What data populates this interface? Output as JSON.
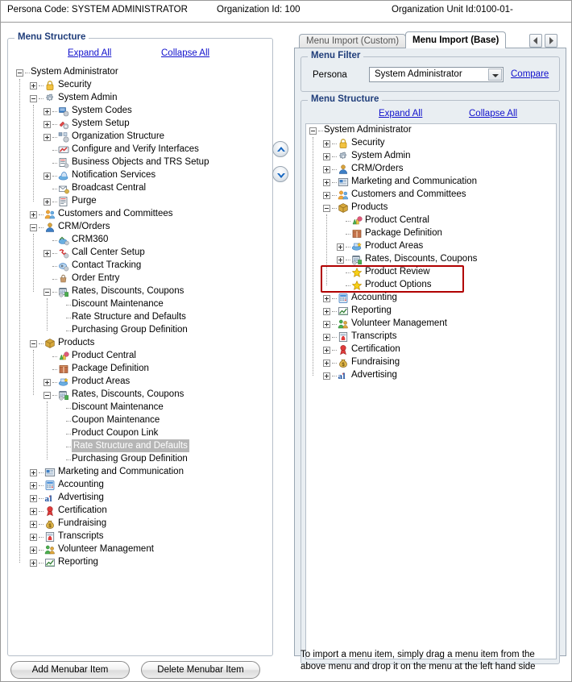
{
  "header": {
    "persona_code": "Persona Code:  SYSTEM ADMINISTRATOR",
    "organization_id": "Organization Id:  100",
    "organization_unit_id": "Organization Unit Id:0100-01-"
  },
  "left_panel": {
    "legend": "Menu Structure",
    "expand_all": "Expand All",
    "collapse_all": "Collapse All",
    "tree": [
      {
        "label": "System Administrator",
        "depth": 0,
        "toggle": "minus",
        "icon": "none"
      },
      {
        "label": "Security",
        "depth": 1,
        "toggle": "plus",
        "icon": "lock"
      },
      {
        "label": "System Admin",
        "depth": 1,
        "toggle": "minus",
        "icon": "gear"
      },
      {
        "label": "System Codes",
        "depth": 2,
        "toggle": "plus",
        "icon": "codes"
      },
      {
        "label": "System Setup",
        "depth": 2,
        "toggle": "plus",
        "icon": "setup"
      },
      {
        "label": "Organization Structure",
        "depth": 2,
        "toggle": "plus",
        "icon": "orgstruct"
      },
      {
        "label": "Configure and Verify Interfaces",
        "depth": 2,
        "toggle": "none",
        "icon": "interfaces"
      },
      {
        "label": "Business Objects and TRS Setup",
        "depth": 2,
        "toggle": "none",
        "icon": "bizobj"
      },
      {
        "label": "Notification Services",
        "depth": 2,
        "toggle": "plus",
        "icon": "notify"
      },
      {
        "label": "Broadcast Central",
        "depth": 2,
        "toggle": "none",
        "icon": "broadcast"
      },
      {
        "label": "Purge",
        "depth": 2,
        "toggle": "plus",
        "icon": "purge"
      },
      {
        "label": "Customers and Committees",
        "depth": 1,
        "toggle": "plus",
        "icon": "people"
      },
      {
        "label": "CRM/Orders",
        "depth": 1,
        "toggle": "minus",
        "icon": "person"
      },
      {
        "label": "CRM360",
        "depth": 2,
        "toggle": "none",
        "icon": "crm360"
      },
      {
        "label": "Call Center Setup",
        "depth": 2,
        "toggle": "plus",
        "icon": "callcenter"
      },
      {
        "label": "Contact Tracking",
        "depth": 2,
        "toggle": "none",
        "icon": "contact"
      },
      {
        "label": "Order Entry",
        "depth": 2,
        "toggle": "none",
        "icon": "order"
      },
      {
        "label": "Rates, Discounts, Coupons",
        "depth": 2,
        "toggle": "minus",
        "icon": "rates"
      },
      {
        "label": "Discount Maintenance",
        "depth": 3,
        "toggle": "none",
        "icon": "none"
      },
      {
        "label": "Rate Structure and Defaults",
        "depth": 3,
        "toggle": "none",
        "icon": "none"
      },
      {
        "label": "Purchasing Group Definition",
        "depth": 3,
        "toggle": "none",
        "icon": "none"
      },
      {
        "label": "Products",
        "depth": 1,
        "toggle": "minus",
        "icon": "box"
      },
      {
        "label": "Product Central",
        "depth": 2,
        "toggle": "none",
        "icon": "prodcentral"
      },
      {
        "label": "Package Definition",
        "depth": 2,
        "toggle": "none",
        "icon": "package"
      },
      {
        "label": "Product Areas",
        "depth": 2,
        "toggle": "plus",
        "icon": "prodareas"
      },
      {
        "label": "Rates, Discounts, Coupons",
        "depth": 2,
        "toggle": "minus",
        "icon": "rates"
      },
      {
        "label": "Discount Maintenance",
        "depth": 3,
        "toggle": "none",
        "icon": "none"
      },
      {
        "label": "Coupon Maintenance",
        "depth": 3,
        "toggle": "none",
        "icon": "none"
      },
      {
        "label": "Product Coupon Link",
        "depth": 3,
        "toggle": "none",
        "icon": "none"
      },
      {
        "label": "Rate Structure and Defaults",
        "depth": 3,
        "toggle": "none",
        "icon": "none",
        "selected": true
      },
      {
        "label": "Purchasing Group Definition",
        "depth": 3,
        "toggle": "none",
        "icon": "none"
      },
      {
        "label": "Marketing and Communication",
        "depth": 1,
        "toggle": "plus",
        "icon": "marketing"
      },
      {
        "label": "Accounting",
        "depth": 1,
        "toggle": "plus",
        "icon": "accounting"
      },
      {
        "label": "Advertising",
        "depth": 1,
        "toggle": "plus",
        "icon": "advertising"
      },
      {
        "label": "Certification",
        "depth": 1,
        "toggle": "plus",
        "icon": "certification"
      },
      {
        "label": "Fundraising",
        "depth": 1,
        "toggle": "plus",
        "icon": "fundraising"
      },
      {
        "label": "Transcripts",
        "depth": 1,
        "toggle": "plus",
        "icon": "transcripts"
      },
      {
        "label": "Volunteer Management",
        "depth": 1,
        "toggle": "plus",
        "icon": "volunteer"
      },
      {
        "label": "Reporting",
        "depth": 1,
        "toggle": "plus",
        "icon": "reporting"
      }
    ]
  },
  "middle": {
    "up_button": "move-up",
    "down_button": "move-down"
  },
  "right_panel": {
    "tabs": [
      {
        "label": "Menu Import (Custom)",
        "active": false
      },
      {
        "label": "Menu Import (Base)",
        "active": true
      }
    ],
    "filter": {
      "legend": "Menu Filter",
      "persona_label": "Persona",
      "persona_value": "System Administrator",
      "compare_link": "Compare"
    },
    "structure": {
      "legend": "Menu Structure",
      "expand_all": "Expand All",
      "collapse_all": "Collapse All"
    },
    "tree": [
      {
        "label": "System Administrator",
        "depth": 0,
        "toggle": "minus",
        "icon": "none"
      },
      {
        "label": "Security",
        "depth": 1,
        "toggle": "plus",
        "icon": "lock"
      },
      {
        "label": "System Admin",
        "depth": 1,
        "toggle": "plus",
        "icon": "gear"
      },
      {
        "label": "CRM/Orders",
        "depth": 1,
        "toggle": "plus",
        "icon": "person"
      },
      {
        "label": "Marketing and Communication",
        "depth": 1,
        "toggle": "plus",
        "icon": "marketing"
      },
      {
        "label": "Customers and Committees",
        "depth": 1,
        "toggle": "plus",
        "icon": "people"
      },
      {
        "label": "Products",
        "depth": 1,
        "toggle": "minus",
        "icon": "box"
      },
      {
        "label": "Product Central",
        "depth": 2,
        "toggle": "none",
        "icon": "prodcentral"
      },
      {
        "label": "Package Definition",
        "depth": 2,
        "toggle": "none",
        "icon": "package"
      },
      {
        "label": "Product Areas",
        "depth": 2,
        "toggle": "plus",
        "icon": "prodareas"
      },
      {
        "label": "Rates, Discounts, Coupons",
        "depth": 2,
        "toggle": "plus",
        "icon": "rates"
      },
      {
        "label": "Product Review",
        "depth": 2,
        "toggle": "none",
        "icon": "star",
        "highlighted": true
      },
      {
        "label": "Product Options",
        "depth": 2,
        "toggle": "none",
        "icon": "star",
        "highlighted": true
      },
      {
        "label": "Accounting",
        "depth": 1,
        "toggle": "plus",
        "icon": "accounting"
      },
      {
        "label": "Reporting",
        "depth": 1,
        "toggle": "plus",
        "icon": "reporting"
      },
      {
        "label": "Volunteer Management",
        "depth": 1,
        "toggle": "plus",
        "icon": "volunteer"
      },
      {
        "label": "Transcripts",
        "depth": 1,
        "toggle": "plus",
        "icon": "transcripts"
      },
      {
        "label": "Certification",
        "depth": 1,
        "toggle": "plus",
        "icon": "certification"
      },
      {
        "label": "Fundraising",
        "depth": 1,
        "toggle": "plus",
        "icon": "fundraising"
      },
      {
        "label": "Advertising",
        "depth": 1,
        "toggle": "plus",
        "icon": "advertising"
      }
    ]
  },
  "footer": {
    "add_button": "Add Menubar Item",
    "delete_button": "Delete Menubar Item",
    "hint_line1": "To import a menu item, simply drag a menu item from the",
    "hint_line2": "above menu and drop it on the menu at the left hand side"
  },
  "colors": {
    "legend_blue": "#1F3D7A",
    "link_blue": "#1111CC",
    "annotation_red": "#B10000",
    "selection_gray": "#B6B6B6",
    "panel_bg": "#E9EEF2"
  }
}
